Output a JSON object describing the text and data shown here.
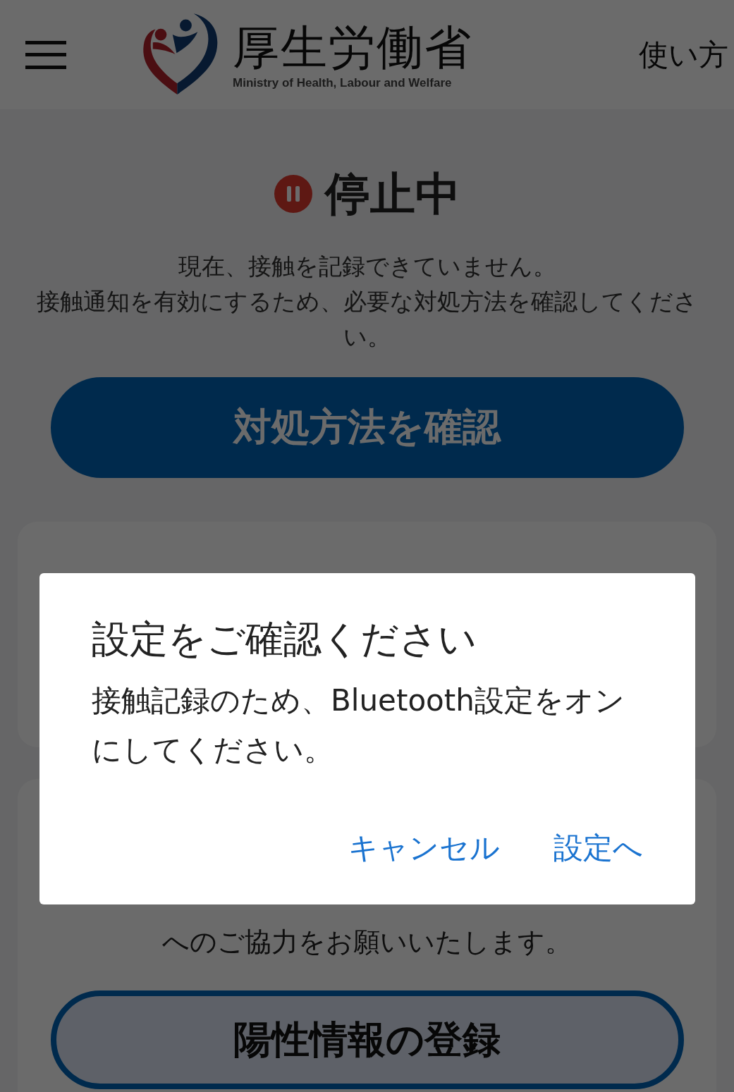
{
  "header": {
    "title": "厚生労働省",
    "subtitle": "Ministry of Health, Labour and Welfare",
    "help_link": "使い方"
  },
  "status": {
    "label": "停止中",
    "kind": "paused",
    "message": [
      "現在、接触を記録できていません。",
      "接触通知を有効にするため、必要な対処方法を確認してください。"
    ],
    "button": "対処方法を確認"
  },
  "register_card": {
    "text": "へのご協力をお願いいたします。",
    "button": "陽性情報の登録"
  },
  "dialog": {
    "title": "設定をご確認ください",
    "message": "接触記録のため、Bluetooth設定をオンにしてください。",
    "buttons": [
      "キャンセル",
      "設定へ"
    ]
  }
}
